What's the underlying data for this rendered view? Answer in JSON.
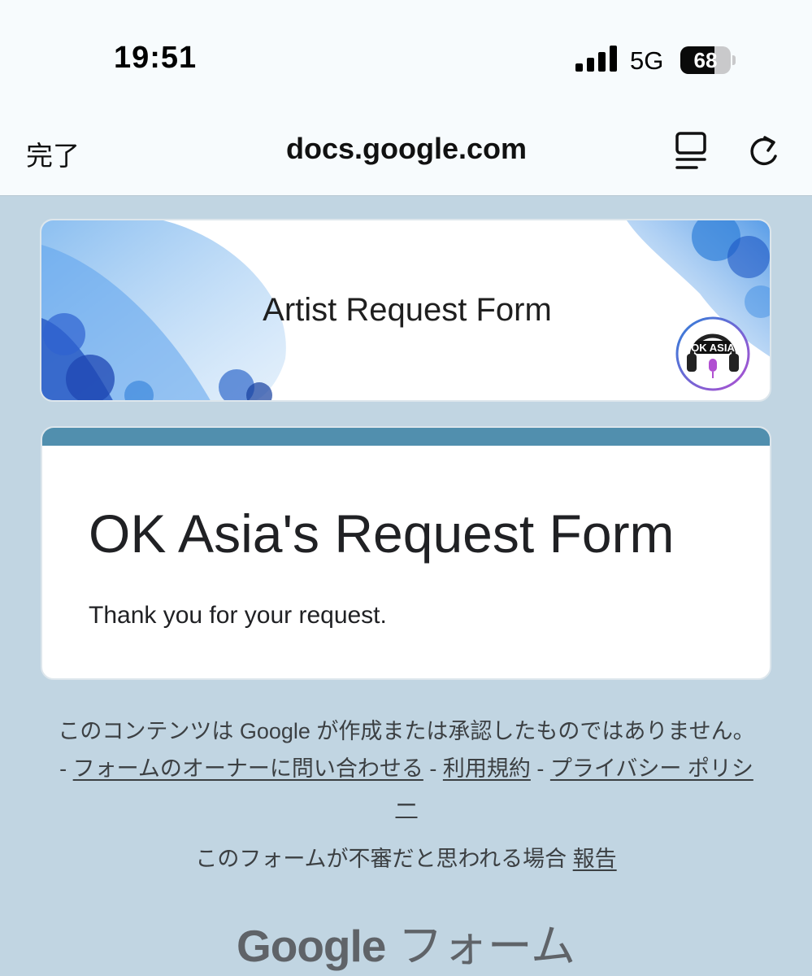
{
  "status_bar": {
    "time": "19:51",
    "network": "5G",
    "battery_level": "68",
    "battery_fraction": 0.68,
    "icons": [
      "signal-bars-icon",
      "battery-icon"
    ]
  },
  "browser": {
    "done_label": "完了",
    "url": "docs.google.com",
    "icons": [
      "reader-mode-icon",
      "reload-icon"
    ]
  },
  "header": {
    "banner_title": "Artist Request Form",
    "logo_text": "OK ASIA",
    "art_colors": [
      "#2f7fd8",
      "#7fb8ef",
      "#1d4fbf"
    ]
  },
  "form": {
    "title": "OK Asia's Request Form",
    "message": "Thank you for your request.",
    "accent_color": "#518fae"
  },
  "footer": {
    "disclaimer_text": "このコンテンツは Google が作成または承認したものではありません。",
    "separator_1": " - ",
    "contact_owner_link": "フォームのオーナーに問い合わせる",
    "separator_2": " - ",
    "terms_link": "利用規約",
    "separator_3": " - ",
    "privacy_link": "プライバシー ポリシー",
    "report_text": "このフォームが不審だと思われる場合 ",
    "report_link": "報告",
    "brand_google": "Google",
    "brand_forms": "フォーム"
  },
  "colors": {
    "page_background": "#c1d5e2",
    "bar_background": "#f7fbfd",
    "accent": "#518fae"
  }
}
